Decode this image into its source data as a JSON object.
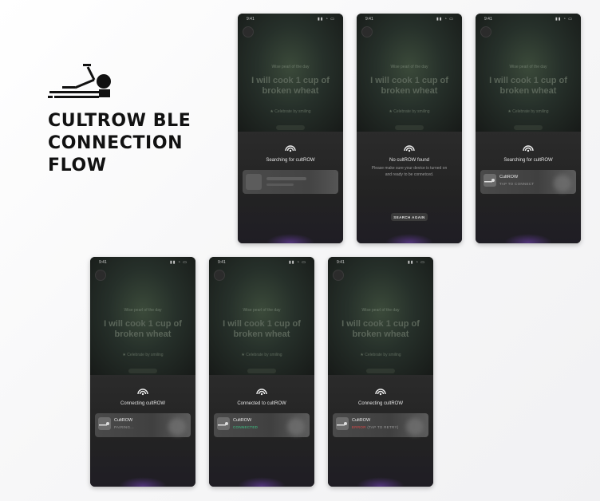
{
  "brand": {
    "title_lines": [
      "CULTROW BLE",
      "CONNECTION",
      "FLOW"
    ],
    "logo_icon": "rowing-machine-icon"
  },
  "phone_common": {
    "time": "9:41",
    "status_icons": "▮▮ ◔ ▭",
    "bg_small": "Wise pearl of the day",
    "bg_quote": "I will cook 1 cup of broken wheat",
    "bg_celebrate": "★ Celebrate by smiling"
  },
  "screens": [
    {
      "title": "Searching for cultROW"
    },
    {
      "title": "No cultROW found",
      "help": "Please make sure your device is turned on and ready to be connetced.",
      "button": "SEARCH AGAIN"
    },
    {
      "title": "Searching for cultROW",
      "device_name": "CultROW",
      "device_status": "TAP TO CONNECT"
    },
    {
      "title": "Connecting cultROW",
      "device_name": "CultROW",
      "device_status": "PAIRING..."
    },
    {
      "title": "Connected to cultROW",
      "device_name": "CultROW",
      "device_status": "CONNECTED"
    },
    {
      "title": "Connecting cultROW",
      "device_name": "CultROW",
      "device_status_error": "ERROR",
      "device_status": " (TAP TO RETRY)"
    }
  ],
  "colors": {
    "status_default": "#9a9a9a",
    "status_connected": "#3fc98a",
    "status_error": "#e04a4a"
  }
}
